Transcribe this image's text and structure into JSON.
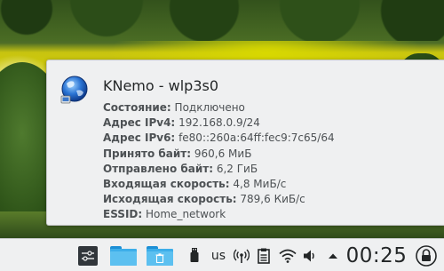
{
  "tooltip": {
    "title": "KNemo - wlp3s0",
    "rows": [
      {
        "key": "Состояние:",
        "value": "Подключено"
      },
      {
        "key": "Адрес IPv4:",
        "value": "192.168.0.9/24"
      },
      {
        "key": "Адрес IPv6:",
        "value": "fe80::260a:64ff:fec9:7c65/64"
      },
      {
        "key": "Принято байт:",
        "value": "960,6 МиБ"
      },
      {
        "key": "Отправлено байт:",
        "value": "6,2 ГиБ"
      },
      {
        "key": "Входящая скорость:",
        "value": "4,8 МиБ/с"
      },
      {
        "key": "Исходящая скорость:",
        "value": "789,6 КиБ/с"
      },
      {
        "key": "ESSID:",
        "value": "Home_network"
      }
    ]
  },
  "panel": {
    "keyboard_layout": "us",
    "clock": "00:25"
  },
  "icons": {
    "tooltip_icon": "knemo-network-globe-icon",
    "settings": "panel-settings-icon",
    "folder1": "folder-icon",
    "folder2": "trash-folder-icon",
    "usb": "usb-icon",
    "broadcast": "network-broadcast-icon",
    "clipboard": "clipboard-icon",
    "wifi": "wifi-icon",
    "volume": "volume-icon",
    "expand": "tray-expand-arrow-icon",
    "lock": "lock-screen-icon"
  },
  "colors": {
    "panel_bg": "#eff0f1",
    "tooltip_bg": "#eff0f1",
    "accent": "#3daee9",
    "text": "#232627"
  }
}
